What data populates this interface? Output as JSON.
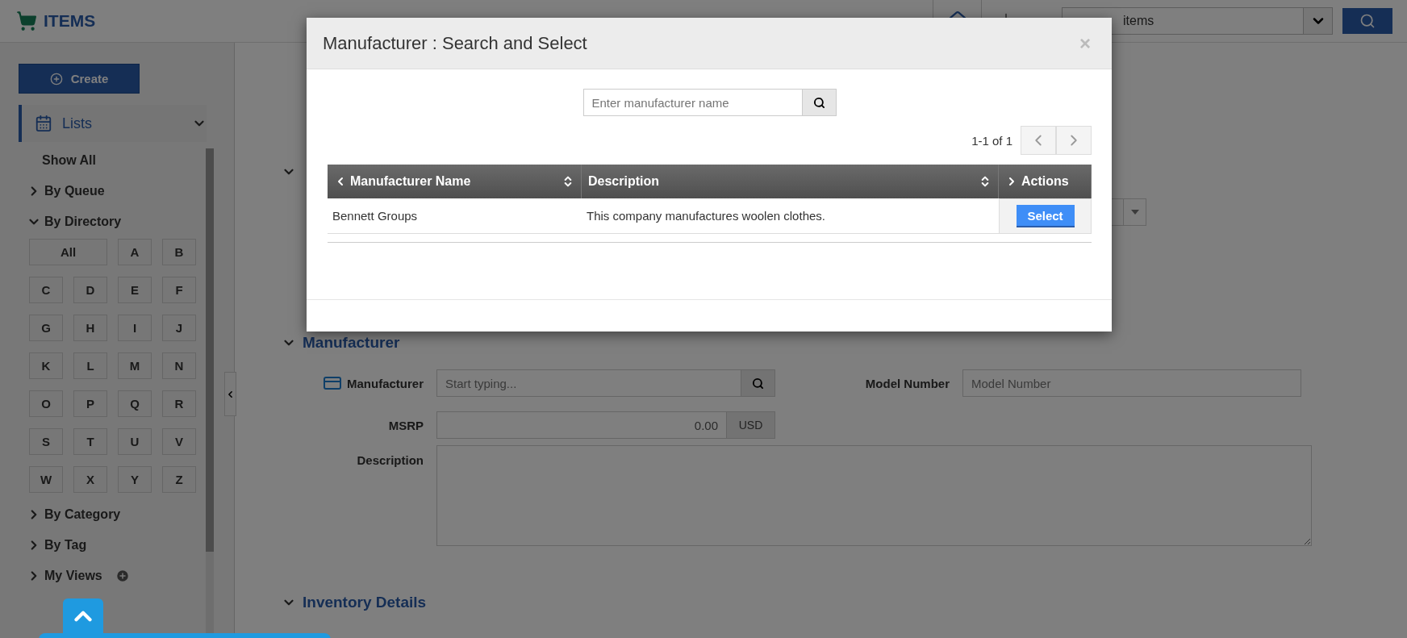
{
  "header": {
    "title": "ITEMS",
    "search": {
      "value": "items"
    }
  },
  "sidebar": {
    "create_label": "Create",
    "lists": {
      "label": "Lists",
      "expanded": true
    },
    "items": [
      {
        "kind": "plain",
        "label": "Show All"
      },
      {
        "kind": "group",
        "label": "By Queue",
        "expanded": false
      },
      {
        "kind": "group",
        "label": "By Directory",
        "expanded": true,
        "letters": [
          "All",
          "A",
          "B",
          "C",
          "D",
          "E",
          "F",
          "G",
          "H",
          "I",
          "J",
          "K",
          "L",
          "M",
          "N",
          "O",
          "P",
          "Q",
          "R",
          "S",
          "T",
          "U",
          "V",
          "W",
          "X",
          "Y",
          "Z"
        ]
      },
      {
        "kind": "group",
        "label": "By Category",
        "expanded": false
      },
      {
        "kind": "group",
        "label": "By Tag",
        "expanded": false
      },
      {
        "kind": "views",
        "label": "My Views",
        "expanded": false
      }
    ]
  },
  "form": {
    "sections": [
      {
        "expanded": true,
        "rows": [
          {
            "kind": "select"
          }
        ]
      },
      {
        "title": "Manufacturer",
        "expanded": true,
        "rows": [
          {
            "kind": "pair",
            "left": {
              "label": "Manufacturer",
              "kind": "lookup",
              "placeholder": "Start typing..."
            },
            "right": {
              "label": "Model Number",
              "kind": "text",
              "placeholder": "Model Number"
            }
          },
          {
            "kind": "pair",
            "left": {
              "label": "MSRP",
              "kind": "money",
              "value": "0.00",
              "unit": "USD"
            }
          },
          {
            "kind": "area",
            "label": "Description"
          }
        ]
      },
      {
        "title": "Inventory Details",
        "expanded": true
      }
    ]
  },
  "modal": {
    "title": "Manufacturer : Search and Select",
    "close": "×",
    "search": {
      "placeholder": "Enter manufacturer name"
    },
    "pagination": "1-1 of 1",
    "table": {
      "columns": [
        "Manufacturer Name",
        "Description",
        "Actions"
      ],
      "rows": [
        {
          "name": "Bennett Groups",
          "description": "This company manufactures woolen clothes.",
          "action": "Select"
        }
      ]
    }
  }
}
